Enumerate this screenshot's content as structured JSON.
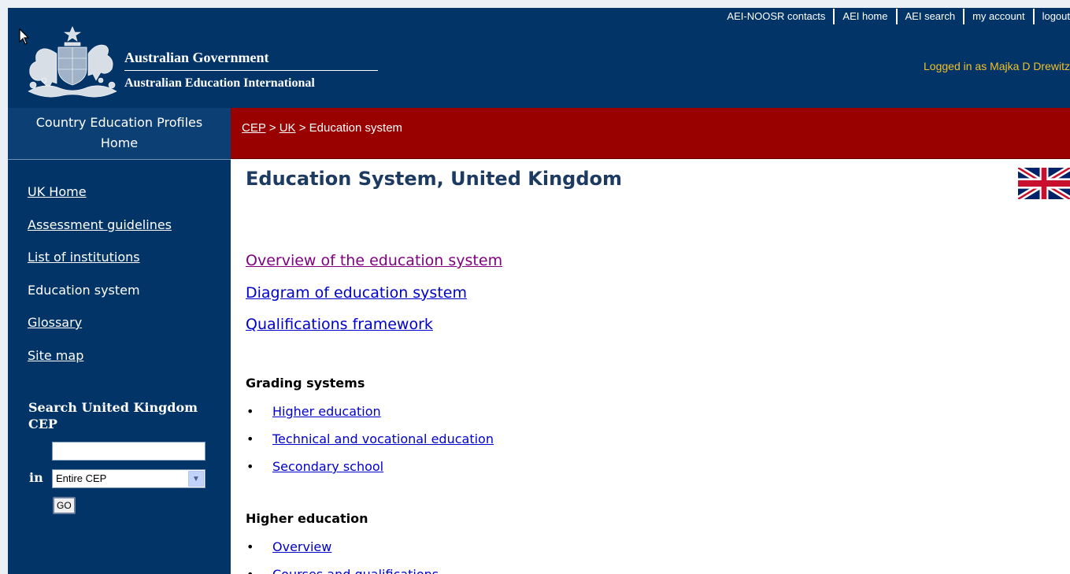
{
  "header": {
    "top_links": [
      "AEI-NOOSR contacts",
      "AEI home",
      "AEI search",
      "my account",
      "logout"
    ],
    "gov_title": "Australian Government",
    "org_title": "Australian Education International",
    "logged_in": "Logged in as Majka D Drewitz"
  },
  "sidebar": {
    "title_line1": "Country Education Profiles",
    "title_line2": "Home",
    "items": [
      {
        "label": "UK Home",
        "link": true
      },
      {
        "label": "Assessment guidelines",
        "link": true
      },
      {
        "label": "List of institutions",
        "link": true
      },
      {
        "label": "Education system",
        "link": false
      },
      {
        "label": "Glossary",
        "link": true
      },
      {
        "label": "Site map",
        "link": true
      }
    ],
    "search_title": "Search United Kingdom CEP",
    "search_value": "",
    "in_label": "in",
    "scope_selected": "Entire CEP",
    "go_label": "GO"
  },
  "breadcrumb": {
    "cep": "CEP",
    "sep1": " > ",
    "uk": "UK",
    "sep2": " > ",
    "current": "Education system"
  },
  "main": {
    "title": "Education System, United Kingdom",
    "links": [
      "Overview of the education system",
      "Diagram of education system",
      "Qualifications framework"
    ],
    "grading_title": "Grading systems",
    "grading_items": [
      "Higher education",
      "Technical and vocational education",
      "Secondary school"
    ],
    "higher_title": "Higher education",
    "higher_items": [
      "Overview",
      "Courses and qualifications"
    ]
  },
  "colors": {
    "header_bg": "#023467",
    "crumb_bg": "#990000",
    "logged_in_text": "#f2c029",
    "link": "#0000cc",
    "visited_link": "#800080"
  },
  "icons": [
    "pointer-cursor-icon",
    "coat-of-arms-icon",
    "uk-flag-icon",
    "dropdown-arrow-icon"
  ]
}
